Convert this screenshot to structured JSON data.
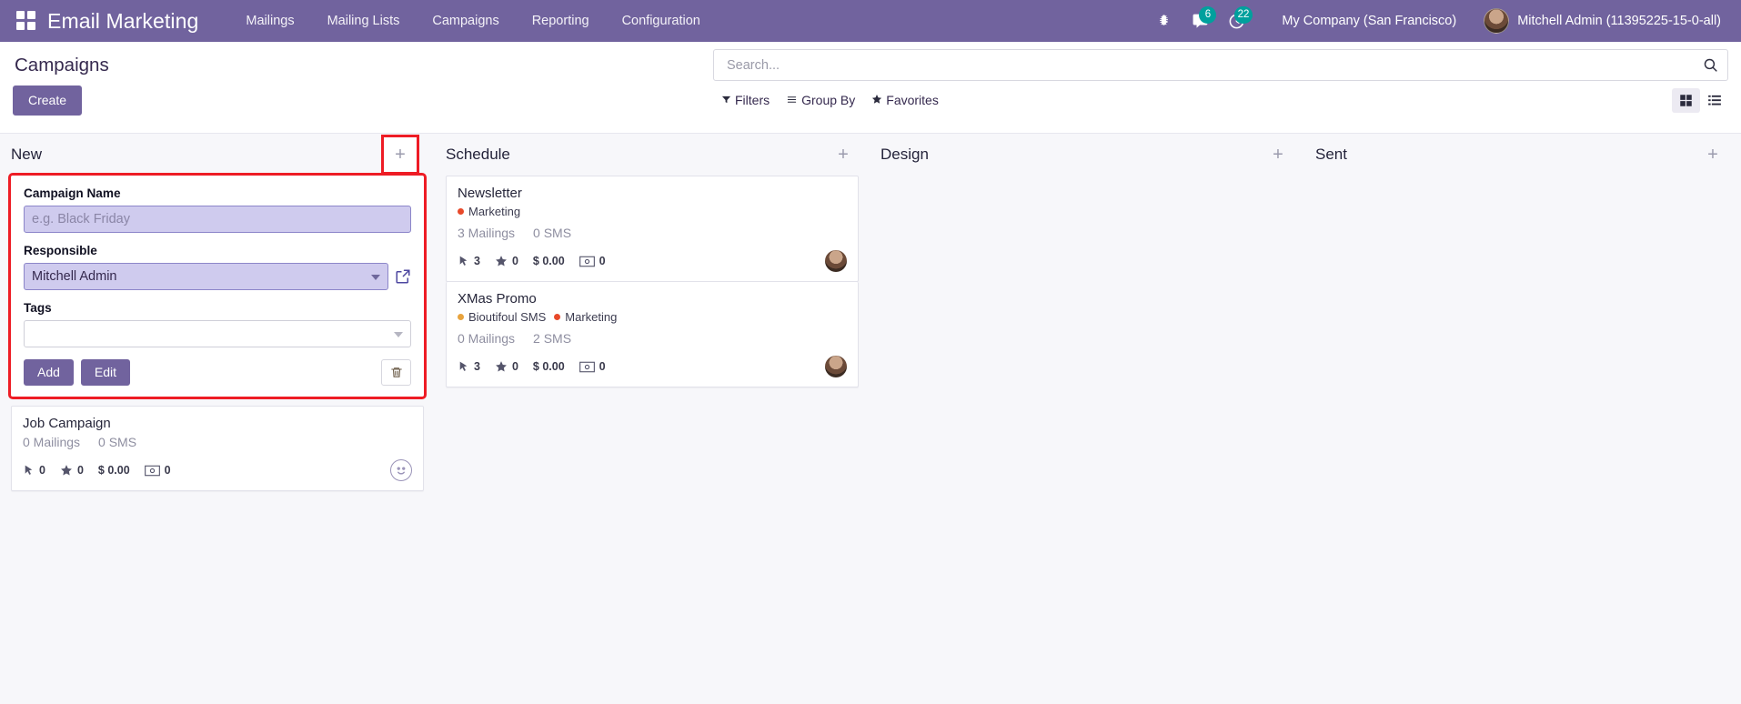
{
  "navbar": {
    "apps_icon": "apps-grid-icon",
    "brand": "Email Marketing",
    "menu": [
      {
        "label": "Mailings"
      },
      {
        "label": "Mailing Lists"
      },
      {
        "label": "Campaigns"
      },
      {
        "label": "Reporting"
      },
      {
        "label": "Configuration"
      }
    ],
    "sys_icons": [
      {
        "name": "debug-bug-icon",
        "badge": null
      },
      {
        "name": "messages-icon",
        "badge": "6"
      },
      {
        "name": "activities-clock-icon",
        "badge": "22"
      }
    ],
    "company": "My Company (San Francisco)",
    "user": "Mitchell Admin (11395225-15-0-all)",
    "accent_color": "#71639e",
    "badge_color": "#00a09d"
  },
  "control_panel": {
    "page_title": "Campaigns",
    "create_label": "Create",
    "search": {
      "value": "",
      "placeholder": "Search..."
    },
    "filters": [
      {
        "label": "Filters",
        "icon": "filter-icon"
      },
      {
        "label": "Group By",
        "icon": "group-by-icon"
      },
      {
        "label": "Favorites",
        "icon": "star-icon"
      }
    ],
    "views": [
      {
        "name": "kanban-view",
        "active": true
      },
      {
        "name": "list-view",
        "active": false
      }
    ]
  },
  "kanban": {
    "columns": [
      {
        "title": "New",
        "add_icon": "plus-icon",
        "add_highlighted": true,
        "quick_create": {
          "highlighted": true,
          "name_label": "Campaign Name",
          "name_value": "",
          "name_placeholder": "e.g. Black Friday",
          "responsible_label": "Responsible",
          "responsible_value": "Mitchell Admin",
          "tags_label": "Tags",
          "tags_value": "",
          "add_label": "Add",
          "edit_label": "Edit",
          "delete_icon": "trash-icon",
          "external_link_icon": "external-link-icon"
        },
        "cards": [
          {
            "title": "Job Campaign",
            "tags": [],
            "mailings": "0 Mailings",
            "sms": "0 SMS",
            "stats": {
              "clicks": "0",
              "leads": "0",
              "revenue": "$ 0.00",
              "invoiced": "0"
            },
            "avatar": "smiley-placeholder-avatar"
          }
        ]
      },
      {
        "title": "Schedule",
        "add_icon": "plus-icon",
        "add_highlighted": false,
        "cards": [
          {
            "title": "Newsletter",
            "tags": [
              {
                "label": "Marketing",
                "color": "#e8492a"
              }
            ],
            "mailings": "3 Mailings",
            "sms": "0 SMS",
            "stats": {
              "clicks": "3",
              "leads": "0",
              "revenue": "$ 0.00",
              "invoiced": "0"
            },
            "avatar": "mitchell-admin-avatar"
          },
          {
            "title": "XMas Promo",
            "tags": [
              {
                "label": "Bioutifoul SMS",
                "color": "#e8a33d"
              },
              {
                "label": "Marketing",
                "color": "#e8492a"
              }
            ],
            "mailings": "0 Mailings",
            "sms": "2 SMS",
            "stats": {
              "clicks": "3",
              "leads": "0",
              "revenue": "$ 0.00",
              "invoiced": "0"
            },
            "avatar": "mitchell-admin-avatar"
          }
        ]
      },
      {
        "title": "Design",
        "add_icon": "plus-icon",
        "add_highlighted": false,
        "cards": []
      },
      {
        "title": "Sent",
        "add_icon": "plus-icon",
        "add_highlighted": false,
        "cards": []
      }
    ]
  }
}
